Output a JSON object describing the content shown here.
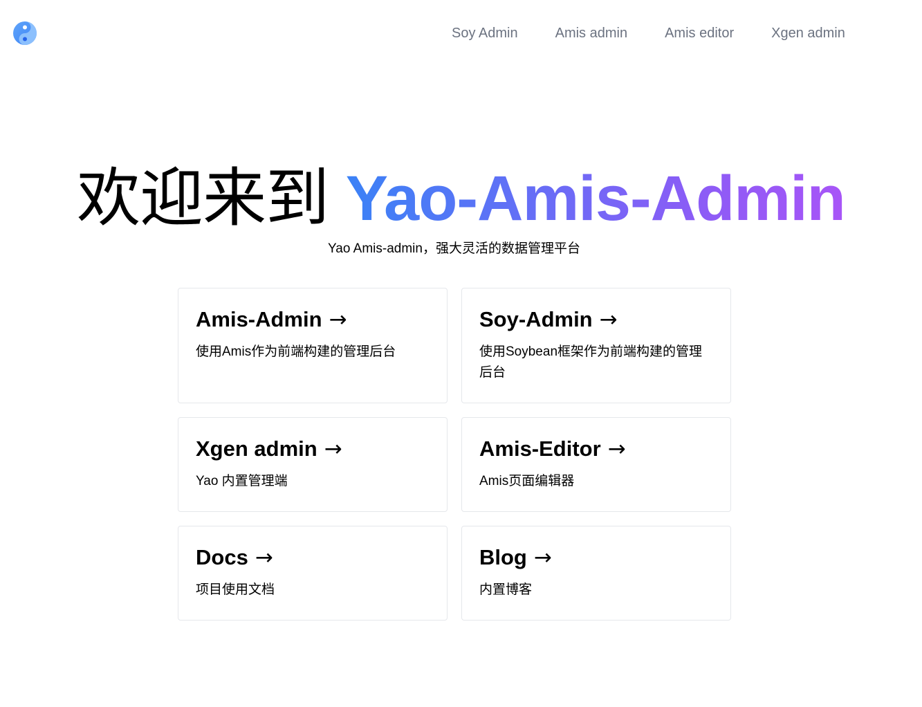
{
  "header": {
    "logo": "yao-logo-icon",
    "nav": [
      {
        "label": "Soy Admin"
      },
      {
        "label": "Amis admin"
      },
      {
        "label": "Amis editor"
      },
      {
        "label": "Xgen admin"
      }
    ]
  },
  "hero": {
    "welcome": "欢迎来到",
    "brand": "Yao-Amis-Admin",
    "subtitle": "Yao Amis-admin，强大灵活的数据管理平台"
  },
  "cards": [
    {
      "title": "Amis-Admin",
      "arrow": "→",
      "desc": "使用Amis作为前端构建的管理后台"
    },
    {
      "title": "Soy-Admin",
      "arrow": "→",
      "desc": "使用Soybean框架作为前端构建的管理后台"
    },
    {
      "title": "Xgen admin",
      "arrow": "→",
      "desc": "Yao 内置管理端"
    },
    {
      "title": "Amis-Editor",
      "arrow": "→",
      "desc": "Amis页面编辑器"
    },
    {
      "title": "Docs",
      "arrow": "→",
      "desc": "项目使用文档"
    },
    {
      "title": "Blog",
      "arrow": "→",
      "desc": "内置博客"
    }
  ],
  "colors": {
    "brand_gradient_start": "#3b82f6",
    "brand_gradient_end": "#a855f7",
    "nav_text": "#6b7280",
    "card_border": "#e5e7eb"
  }
}
